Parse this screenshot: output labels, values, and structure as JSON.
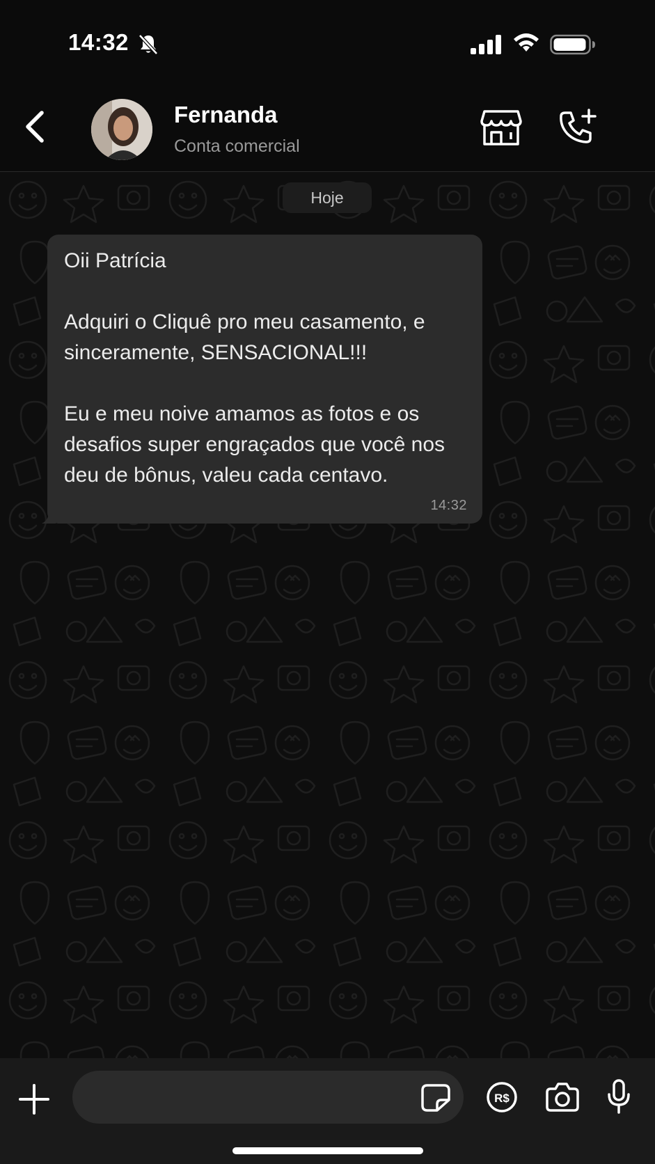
{
  "status_bar": {
    "time": "14:32",
    "icons": [
      "bell-slash-icon",
      "signal-icon",
      "wifi-icon",
      "battery-icon"
    ]
  },
  "header": {
    "back_icon": "chevron-left-icon",
    "contact_name": "Fernanda",
    "contact_subtitle": "Conta comercial",
    "actions": [
      "storefront-icon",
      "phone-plus-icon"
    ]
  },
  "chat": {
    "date_label": "Hoje",
    "messages": [
      {
        "direction": "incoming",
        "text": "Oii Patrícia\n\nAdquiri o Cliquê pro meu casamento, e sinceramente, SENSACIONAL!!!\n\nEu e meu noive amamos as fotos e os desafios super engraçados que você nos deu de bônus, valeu cada centavo.",
        "time": "14:32"
      }
    ]
  },
  "input_bar": {
    "message_value": "",
    "message_placeholder": "",
    "icons": [
      "plus-icon",
      "sticker-icon",
      "payment-icon",
      "camera-icon",
      "microphone-icon"
    ]
  },
  "colors": {
    "background": "#0b0b0b",
    "bubble": "#2c2c2c",
    "input_bar": "#1a1a1a",
    "secondary_text": "#9a9a9a"
  }
}
